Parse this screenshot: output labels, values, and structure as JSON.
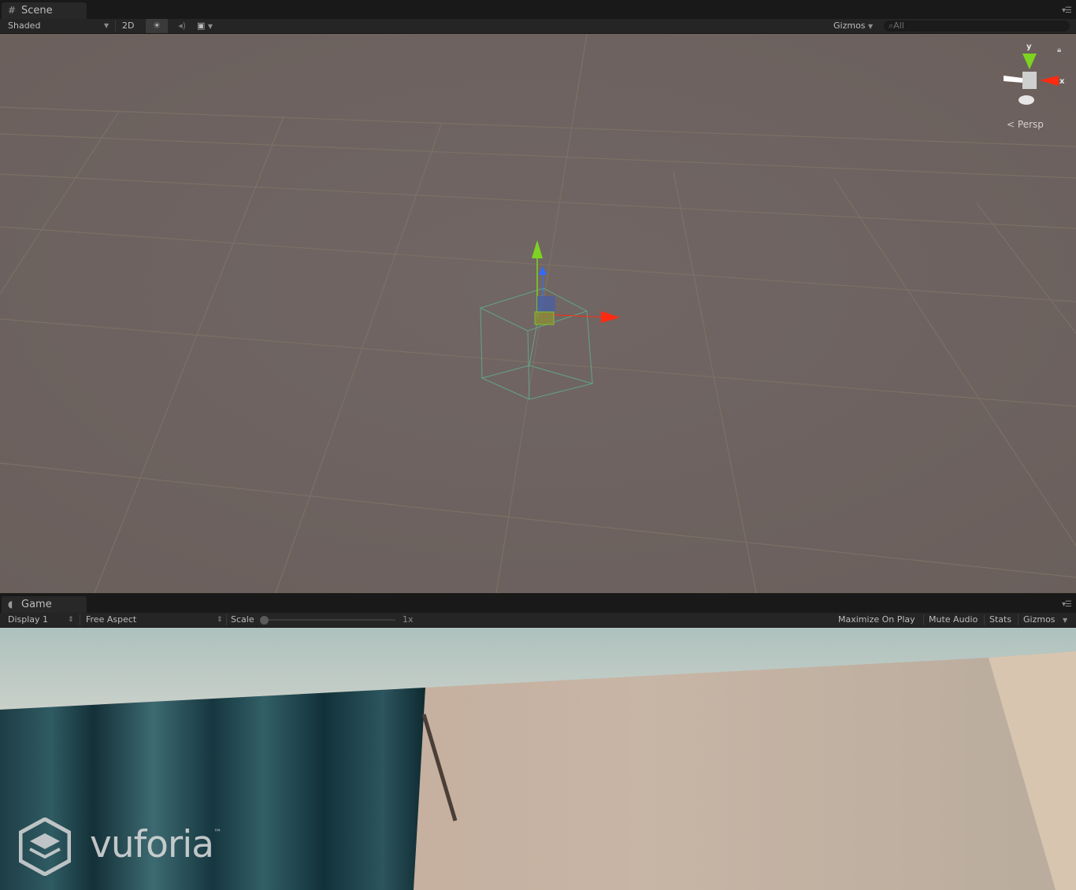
{
  "scene_panel": {
    "tab_label": "Scene",
    "tab_icon": "grid-icon",
    "shading_mode": "Shaded",
    "mode_2d_label": "2D",
    "gizmos_label": "Gizmos",
    "search_placeholder": "All",
    "orientation_gizmo": {
      "y_label": "y",
      "x_label": "x",
      "projection_label": "Persp"
    }
  },
  "game_panel": {
    "tab_label": "Game",
    "tab_icon": "pacman-icon",
    "display_label": "Display 1",
    "aspect_label": "Free Aspect",
    "scale_label": "Scale",
    "scale_value": "1x",
    "maximize_on_play_label": "Maximize On Play",
    "mute_audio_label": "Mute Audio",
    "stats_label": "Stats",
    "gizmos_label": "Gizmos",
    "watermark_brand": "vuforia",
    "watermark_tm": "™"
  },
  "colors": {
    "scene_background": "#6f6461",
    "axis_x": "#ff2a10",
    "axis_y": "#7ed321",
    "axis_z": "#2f6bff"
  }
}
